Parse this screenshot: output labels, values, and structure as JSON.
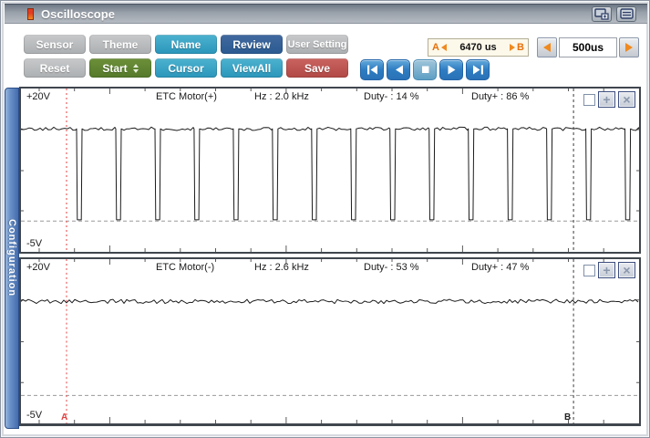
{
  "window": {
    "title": "Oscilloscope",
    "titlebar_buttons": [
      {
        "name": "new-window"
      },
      {
        "name": "tile-windows"
      }
    ]
  },
  "toolbar": {
    "row1": [
      {
        "label": "Sensor",
        "style": "gray"
      },
      {
        "label": "Theme",
        "style": "gray"
      },
      {
        "label": "Name",
        "style": "teal"
      },
      {
        "label": "Review",
        "style": "blue"
      },
      {
        "label": "User Setting",
        "style": "gray"
      }
    ],
    "row2": [
      {
        "label": "Reset",
        "style": "gray"
      },
      {
        "label": "Start",
        "style": "green"
      },
      {
        "label": "Cursor",
        "style": "teal"
      },
      {
        "label": "ViewAll",
        "style": "teal"
      },
      {
        "label": "Save",
        "style": "red"
      }
    ],
    "ab_readout": {
      "a": "A",
      "value": "6470 us",
      "b": "B"
    },
    "timebase": {
      "value": "500us"
    }
  },
  "playback": {
    "buttons": [
      "skip-to-start",
      "step-back",
      "stop",
      "play",
      "skip-to-end"
    ]
  },
  "sidebar": {
    "label": "Configuration"
  },
  "channels": [
    {
      "v_top": "+20V",
      "v_bottom": "-5V",
      "name": "ETC Motor(+)",
      "hz": "Hz : 2.0 kHz",
      "duty_minus": "Duty- : 14 %",
      "duty_plus": "Duty+ : 86 %"
    },
    {
      "v_top": "+20V",
      "v_bottom": "-5V",
      "name": "ETC Motor(-)",
      "hz": "Hz : 2.6 kHz",
      "duty_minus": "Duty- : 53 %",
      "duty_plus": "Duty+ : 47 %"
    }
  ],
  "cursors": {
    "a_label": "A",
    "b_label": "B",
    "a_x_frac": 0.0737,
    "b_x_frac": 0.894
  },
  "colors": {
    "accent_teal": "#2f9fc1",
    "accent_dark_blue": "#2d5f97",
    "accent_green": "#5d7e2f",
    "accent_red": "#bf4f4b",
    "button_gray": "#b5b7b9",
    "playback_blue": "#2f7fc4",
    "orange_accent": "#f08a1e",
    "cursor_a_red": "#e86060",
    "cursor_b_dark": "#3a3a3a",
    "config_tab_blue": "#4d76b2",
    "waveform": "#1c1c1c"
  },
  "chart_data": [
    {
      "type": "line",
      "title": "ETC Motor(+)",
      "signal": "pwm",
      "frequency_khz": 2.0,
      "period_us": 500,
      "duty_low_pct": 14,
      "duty_high_pct": 86,
      "high_level_v": 14.3,
      "low_level_v": -1.0,
      "ref_low_v": -1.2,
      "ylim": [
        -5,
        20
      ],
      "y_top_label": "+20V",
      "y_bottom_label": "-5V",
      "time_window_us": 7890,
      "ab_interval_us": 6470,
      "first_low_frac": 0.09,
      "noise_amp_v": 0.28
    },
    {
      "type": "line",
      "title": "ETC Motor(-)",
      "signal": "flat-noise",
      "frequency_khz": 2.6,
      "duty_low_pct": 53,
      "duty_high_pct": 47,
      "level_v": 14.0,
      "ref_low_v": -1.7,
      "ylim": [
        -5,
        20
      ],
      "y_top_label": "+20V",
      "y_bottom_label": "-5V",
      "time_window_us": 7890,
      "noise_amp_v": 0.35
    }
  ]
}
